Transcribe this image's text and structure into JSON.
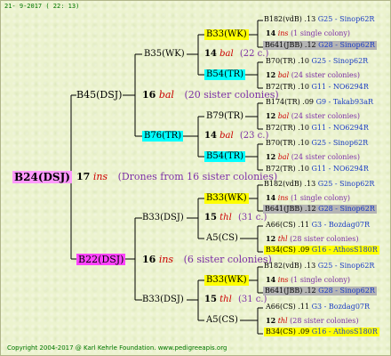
{
  "header": {
    "date": "21- 9-2017 ( 22: 13)"
  },
  "footer": {
    "copyright": "Copyright 2004-2017 @ Karl Kehrle Foundation.   www.pedigreeapis.org"
  },
  "colors": {
    "yellow": "#ffff00",
    "cyan": "#00ffff",
    "grey": "#b4b4b4",
    "pink": "#ff99ff",
    "magenta": "#ff44ff",
    "red": "#cc0000",
    "blue": "#1a3cc4",
    "purple": "#7c2fa6"
  },
  "root": {
    "label": "B24(DSJ)",
    "num": "17",
    "sp": "ins",
    "note": "(Drones from 16 sister colonies)"
  },
  "g1a": {
    "label": "B45(DSJ)",
    "num": "16",
    "sp": "bal",
    "note": "(20 sister colonies)"
  },
  "g1b": {
    "label": "B22(DSJ)",
    "num": "16",
    "sp": "ins",
    "note": "(6 sister colonies)"
  },
  "g2": {
    "a": {
      "label": "B35(WK)",
      "num": "14",
      "sp": "bal",
      "note": "(22 c.)"
    },
    "b": {
      "label": "B76(TR)",
      "num": "14",
      "sp": "bal",
      "note": "(23 c.)"
    },
    "c": {
      "label": "B33(DSJ)",
      "num": "15",
      "sp": "thl",
      "note": "(31 c.)"
    },
    "d": {
      "label": "B33(DSJ)",
      "num": "15",
      "sp": "thl",
      "note": "(31 c.)"
    }
  },
  "g3": {
    "a1": "B33(WK)",
    "a2": "B54(TR)",
    "b1": "B79(TR)",
    "b2": "B54(TR)",
    "c1": "B33(WK)",
    "c2": "A5(CS)",
    "d1": "B33(WK)",
    "d2": "A5(CS)"
  },
  "g4": [
    {
      "pre": "B182(vdB) .13",
      "link": "G25 - Sinop62R"
    },
    {
      "num": "14",
      "sp": "ins",
      "note": "(1 single colony)"
    },
    {
      "pre": "B641(JBB) .12",
      "link": "G28 - Sinop62R"
    },
    {
      "pre": "B70(TR) .10",
      "link": "G25 - Sinop62R"
    },
    {
      "num": "12",
      "sp": "bal",
      "note": "(24 sister colonies)"
    },
    {
      "pre": "B72(TR) .10",
      "link": "G11 - NO6294R"
    },
    {
      "pre": "B174(TR) .09",
      "link": "G9 - Takab93aR"
    },
    {
      "num": "12",
      "sp": "bal",
      "note": "(24 sister colonies)"
    },
    {
      "pre": "B72(TR) .10",
      "link": "G11 - NO6294R"
    },
    {
      "pre": "B70(TR) .10",
      "link": "G25 - Sinop62R"
    },
    {
      "num": "12",
      "sp": "bal",
      "note": "(24 sister colonies)"
    },
    {
      "pre": "B72(TR) .10",
      "link": "G11 - NO6294R"
    },
    {
      "pre": "B182(vdB) .13",
      "link": "G25 - Sinop62R"
    },
    {
      "num": "14",
      "sp": "ins",
      "note": "(1 single colony)"
    },
    {
      "pre": "B641(JBB) .12",
      "link": "G28 - Sinop62R"
    },
    {
      "pre": "A66(CS) .11",
      "link": "G3 - Bozdag07R"
    },
    {
      "num": "12",
      "sp": "thl",
      "note": "(28 sister colonies)"
    },
    {
      "pre": "B34(CS) .09",
      "link": "G16 - AthosS180R"
    },
    {
      "pre": "B182(vdB) .13",
      "link": "G25 - Sinop62R"
    },
    {
      "num": "14",
      "sp": "ins",
      "note": "(1 single colony)"
    },
    {
      "pre": "B641(JBB) .12",
      "link": "G28 - Sinop62R"
    },
    {
      "pre": "A66(CS) .11",
      "link": "G3 - Bozdag07R"
    },
    {
      "num": "12",
      "sp": "thl",
      "note": "(28 sister colonies)"
    },
    {
      "pre": "B34(CS) .09",
      "link": "G16 - AthosS180R"
    }
  ]
}
